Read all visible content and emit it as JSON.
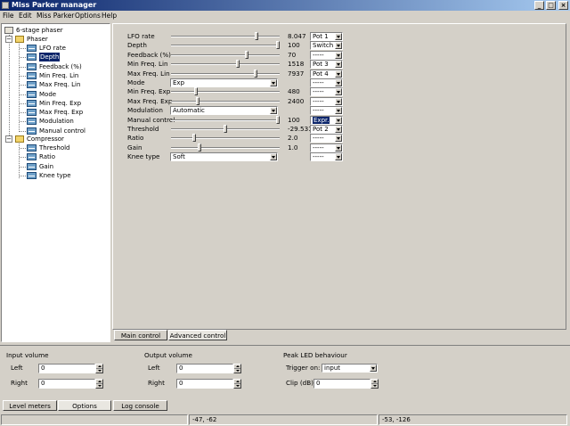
{
  "window": {
    "title": "Miss Parker manager",
    "buttons": {
      "minimize": "_",
      "maximize": "□",
      "close": "×"
    }
  },
  "menu": {
    "file": "File",
    "edit": "Edit",
    "miss_parker": "Miss Parker",
    "options": "Options",
    "help": "Help"
  },
  "tree": {
    "root": "6-stage phaser",
    "phaser": {
      "label": "Phaser",
      "items": [
        "LFO rate",
        "Depth",
        "Feedback (%)",
        "Min Freq. Lin",
        "Max Freq. Lin",
        "Mode",
        "Min Freq. Exp",
        "Max Freq. Exp",
        "Modulation",
        "Manual control"
      ],
      "selected": "Depth"
    },
    "compressor": {
      "label": "Compressor",
      "items": [
        "Threshold",
        "Ratio",
        "Gain",
        "Knee type"
      ]
    }
  },
  "params": [
    {
      "label": "LFO rate",
      "control": "slider",
      "level": 0.8,
      "value": "8.047",
      "assign": "Pot 1"
    },
    {
      "label": "Depth",
      "control": "slider",
      "level": 1.0,
      "value": "100",
      "assign": "Switch"
    },
    {
      "label": "Feedback (%)",
      "control": "slider",
      "level": 0.7,
      "value": "70",
      "assign": "-----"
    },
    {
      "label": "Min Freq. Lin",
      "control": "slider",
      "level": 0.62,
      "value": "1518",
      "assign": "Pot 3"
    },
    {
      "label": "Max Freq. Lin",
      "control": "slider",
      "level": 0.79,
      "value": "7937",
      "assign": "Pot 4"
    },
    {
      "label": "Mode",
      "control": "select",
      "selected": "Exp",
      "assign": "-----"
    },
    {
      "label": "Min Freq. Exp",
      "control": "slider",
      "level": 0.22,
      "value": "480",
      "assign": "-----"
    },
    {
      "label": "Max Freq. Exp",
      "control": "slider",
      "level": 0.24,
      "value": "2400",
      "assign": "-----"
    },
    {
      "label": "Modulation",
      "control": "select",
      "selected": "Automatic",
      "assign": "-----"
    },
    {
      "label": "Manual control",
      "control": "slider",
      "level": 1.0,
      "value": "100",
      "assign": "Expr.",
      "assign_highlight": true
    },
    {
      "label": "Threshold",
      "control": "slider",
      "level": 0.5,
      "value": "-29.531",
      "assign": "Pot 2"
    },
    {
      "label": "Ratio",
      "control": "slider",
      "level": 0.2,
      "value": "2.0",
      "assign": "-----"
    },
    {
      "label": "Gain",
      "control": "slider",
      "level": 0.25,
      "value": "1.0",
      "assign": "-----"
    },
    {
      "label": "Knee type",
      "control": "select",
      "selected": "Soft",
      "assign": "-----"
    }
  ],
  "tabs": {
    "main_control": "Main control",
    "advanced_control": "Advanced control",
    "active": "advanced_control"
  },
  "input_volume": {
    "title": "Input volume",
    "left_label": "Left",
    "left_value": "0",
    "right_label": "Right",
    "right_value": "0"
  },
  "output_volume": {
    "title": "Output volume",
    "left_label": "Left",
    "left_value": "0",
    "right_label": "Right",
    "right_value": "0"
  },
  "peak_led": {
    "title": "Peak LED behaviour",
    "trigger_label": "Trigger on:",
    "trigger_value": "input",
    "clip_label": "Clip (dB):",
    "clip_value": "0"
  },
  "bottom_tabs": {
    "level_meters": "Level meters",
    "options": "Options",
    "log_console": "Log console",
    "active": "options"
  },
  "status": {
    "left_coords": "-47, -62",
    "right_coords": "-53, -126"
  },
  "colors": {
    "face": "#d4d0c8",
    "title_start": "#0a246a",
    "title_end": "#a6caf0",
    "selection": "#0a246a"
  }
}
